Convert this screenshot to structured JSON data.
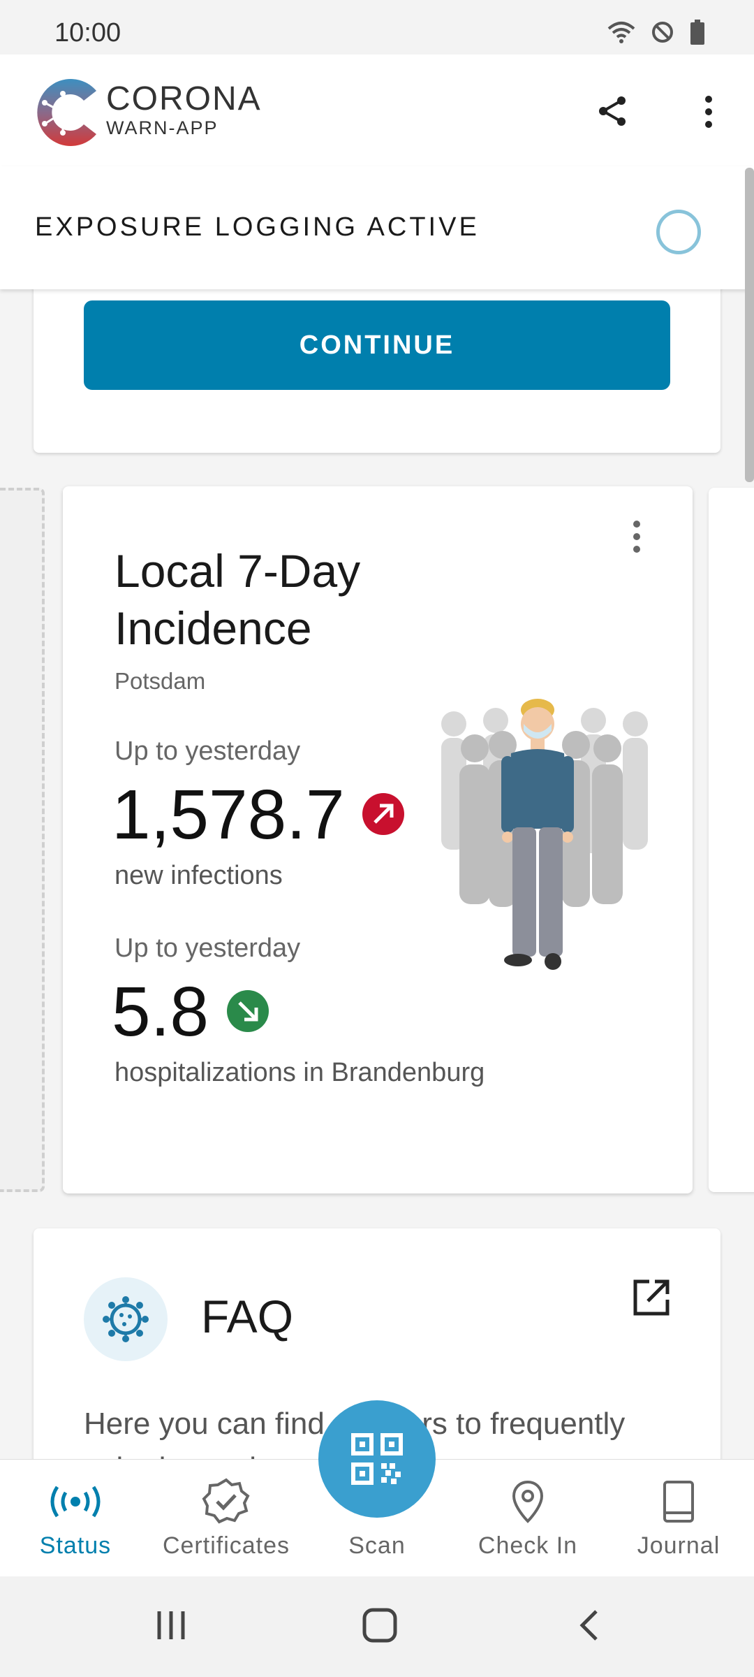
{
  "status_bar": {
    "time": "10:00"
  },
  "header": {
    "brand_name": "CORONA",
    "brand_sub": "WARN-APP"
  },
  "exposure": {
    "label": "EXPOSURE LOGGING ACTIVE"
  },
  "continue_label": "CONTINUE",
  "incidence": {
    "title": "Local 7-Day Incidence",
    "city": "Potsdam",
    "metric1": {
      "period": "Up to yesterday",
      "value": "1,578.7",
      "label": "new infections",
      "trend": "up",
      "color": "#c8102e"
    },
    "metric2": {
      "period": "Up to yesterday",
      "value": "5.8",
      "label": "hospitalizations in Brandenburg",
      "trend": "down",
      "color": "#2a8a4a"
    }
  },
  "faq": {
    "title": "FAQ",
    "text": "Here you can find answers to frequently asked questions and"
  },
  "nav": {
    "items": [
      {
        "label": "Status",
        "icon": "radio-waves-icon",
        "active": true
      },
      {
        "label": "Certificates",
        "icon": "badge-check-icon",
        "active": false
      },
      {
        "label": "Scan",
        "icon": "qr-code-icon",
        "active": false
      },
      {
        "label": "Check In",
        "icon": "location-pin-icon",
        "active": false
      },
      {
        "label": "Journal",
        "icon": "book-icon",
        "active": false
      }
    ]
  },
  "colors": {
    "primary": "#007fad",
    "fab": "#3a9fcf",
    "ring": "#88c3da"
  }
}
